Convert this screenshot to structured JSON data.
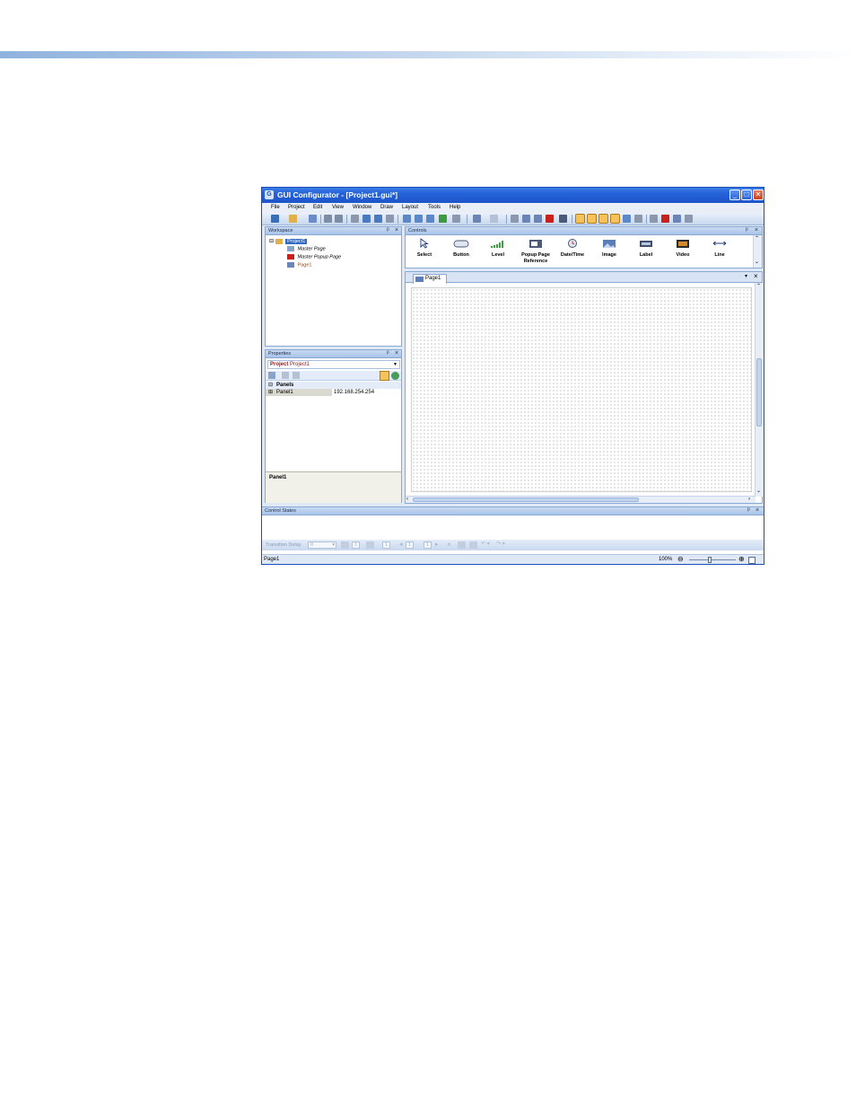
{
  "window": {
    "title": "GUI Configurator - [Project1.gui*]",
    "minimize": "_",
    "maximize": "□",
    "close": "✕"
  },
  "menu": [
    "File",
    "Project",
    "Edit",
    "View",
    "Window",
    "Draw",
    "Layout",
    "Tools",
    "Help"
  ],
  "workspace": {
    "title": "Workspace",
    "tree": {
      "root": "Project1",
      "children": [
        "Master Page",
        "Master Popup Page",
        "Page1"
      ]
    }
  },
  "properties": {
    "title": "Properties",
    "selector_bold": "Project",
    "selector_rest": " Project1",
    "category": "Panels",
    "row_name": "Panel1",
    "row_value": "192.168.254.254",
    "description": "Panel1"
  },
  "controls": {
    "title": "Controls",
    "items": [
      "Select",
      "Button",
      "Level",
      "Popup Page Reference",
      "Date/Time",
      "Image",
      "Label",
      "Video",
      "Line"
    ]
  },
  "document": {
    "tab": "Page1"
  },
  "control_states": {
    "title": "Control States",
    "transition_label": "Transition Delay",
    "transition_value": "0",
    "count_a": "1",
    "count_b": "1",
    "page_a": "1",
    "page_b": "1"
  },
  "statusbar": {
    "left": "Page1",
    "zoom": "100%"
  },
  "colors": {
    "titlebar": "#2461d8",
    "selection": "#316ac5",
    "highlight_toolbar": "#f5c35a"
  }
}
